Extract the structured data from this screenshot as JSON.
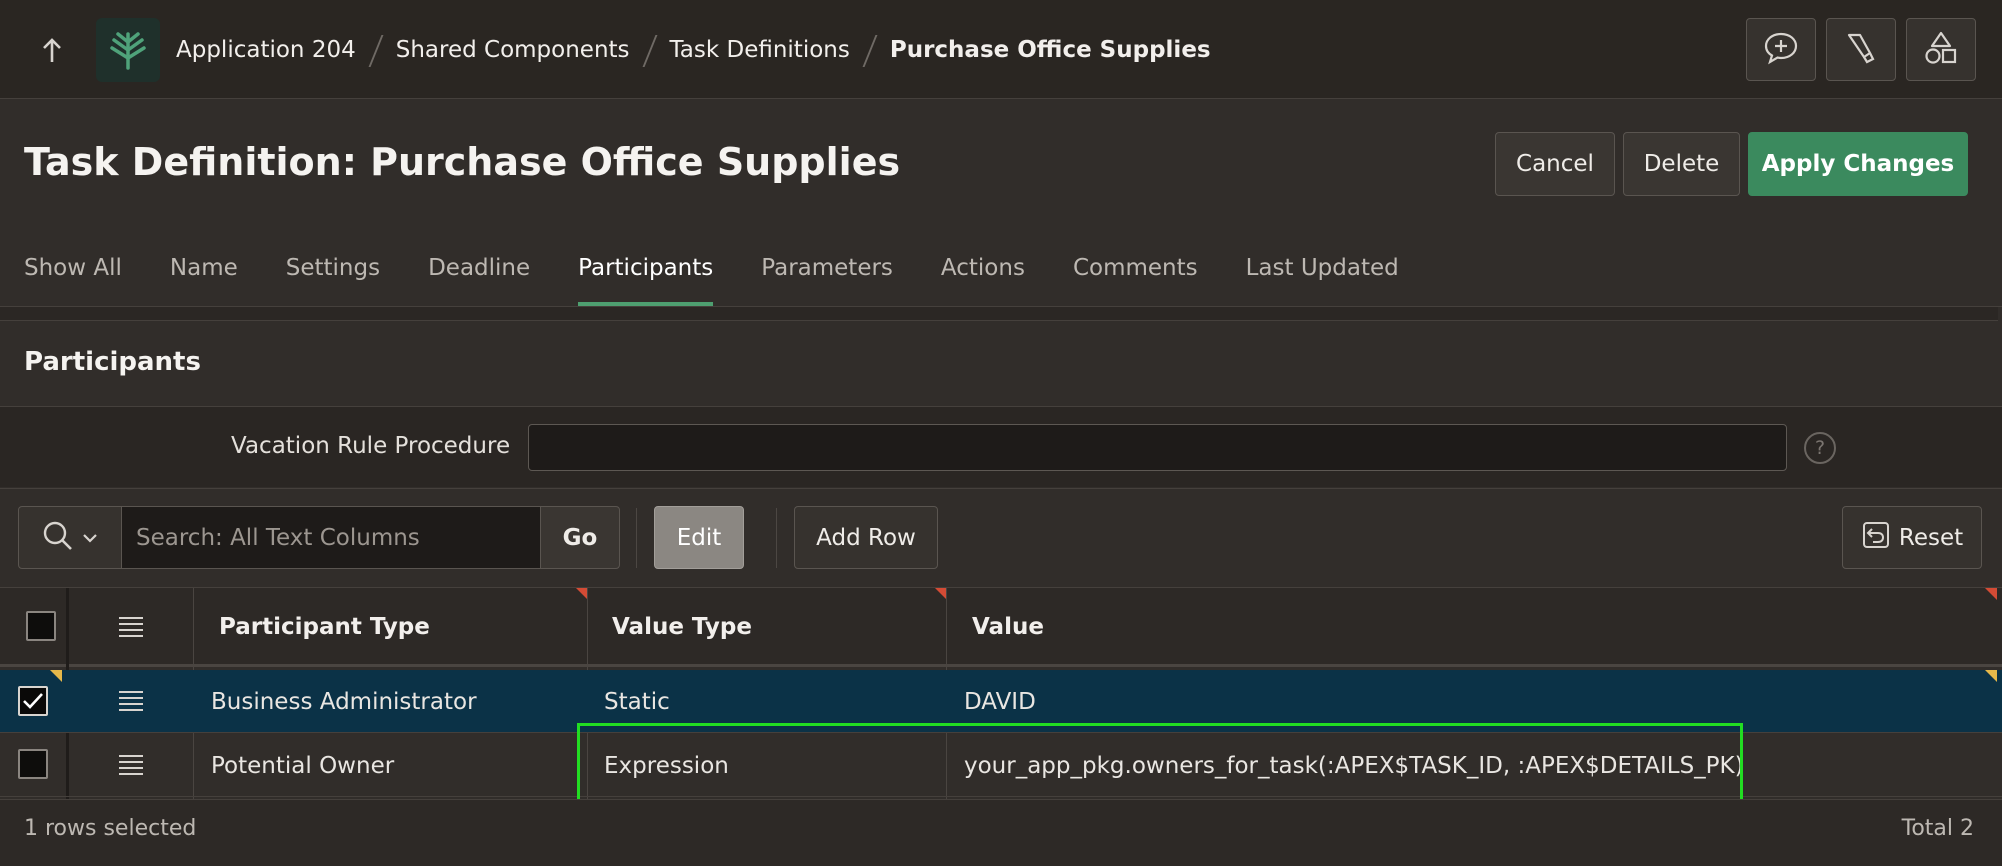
{
  "breadcrumb": [
    "Application 204",
    "Shared Components",
    "Task Definitions",
    "Purchase Office Supplies"
  ],
  "page": {
    "title": "Task Definition: Purchase Office Supplies",
    "cancel_label": "Cancel",
    "delete_label": "Delete",
    "apply_label": "Apply Changes"
  },
  "tabs": [
    "Show All",
    "Name",
    "Settings",
    "Deadline",
    "Participants",
    "Parameters",
    "Actions",
    "Comments",
    "Last Updated"
  ],
  "active_tab": "Participants",
  "region": {
    "title": "Participants",
    "vacation_label": "Vacation Rule Procedure",
    "vacation_value": "",
    "help": "?"
  },
  "toolbar": {
    "search_placeholder": "Search: All Text Columns",
    "go_label": "Go",
    "edit_label": "Edit",
    "add_row_label": "Add Row",
    "reset_label": "Reset"
  },
  "grid": {
    "columns": [
      "Participant Type",
      "Value Type",
      "Value"
    ],
    "rows": [
      {
        "participant_type": "Business Administrator",
        "value_type": "Static",
        "value": "DAVID",
        "selected": true
      },
      {
        "participant_type": "Potential Owner",
        "value_type": "Expression",
        "value": "your_app_pkg.owners_for_task(:APEX$TASK_ID, :APEX$DETAILS_PK)",
        "selected": false
      }
    ]
  },
  "footer": {
    "selection": "1 rows selected",
    "total": "Total 2"
  },
  "colors": {
    "accent": "#3b8a5e",
    "selected_row": "#0b3247",
    "highlight": "#22dd22"
  }
}
